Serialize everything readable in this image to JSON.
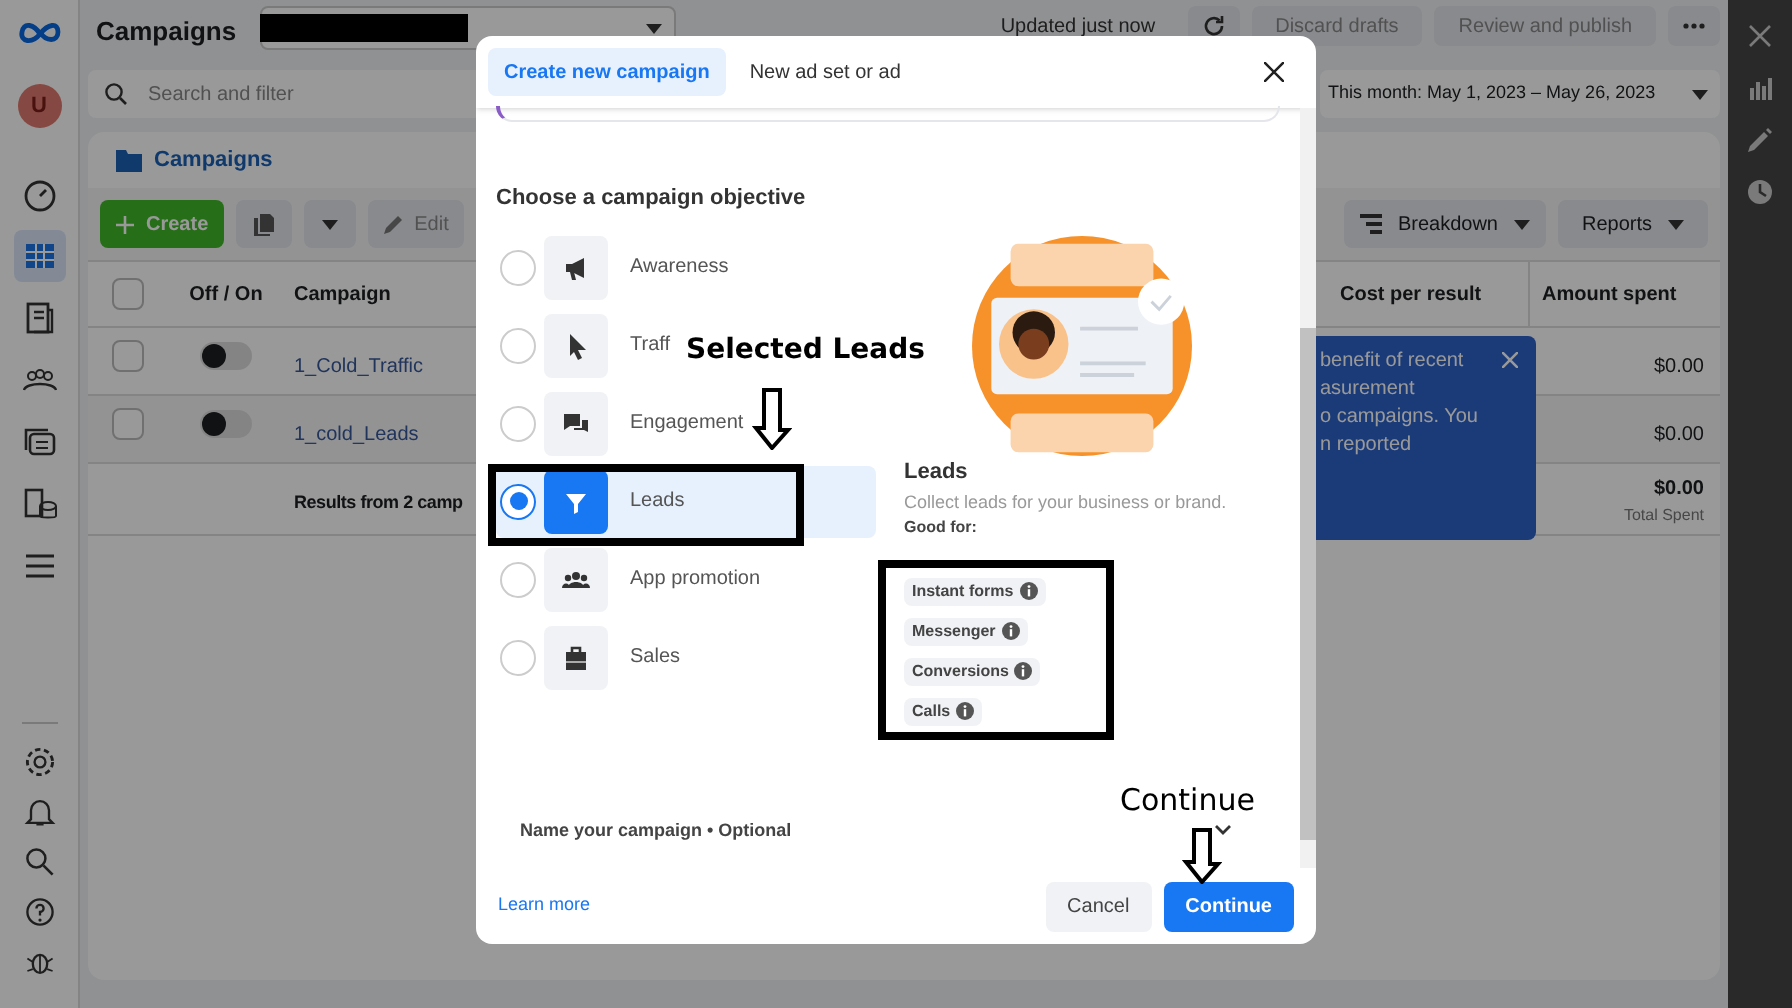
{
  "app": {
    "title": "Campaigns",
    "avatar": "U",
    "updated": "Updated just now",
    "actions": [
      "Discard drafts",
      "Review and publish"
    ],
    "search_placeholder": "Search and filter",
    "date_range": "This month: May 1, 2023 – May 26, 2023"
  },
  "nav_items": [
    {
      "selected": false
    },
    {
      "selected": true
    },
    {
      "selected": false
    },
    {
      "selected": false
    },
    {
      "selected": false
    },
    {
      "selected": false
    },
    {
      "selected": false
    }
  ],
  "panel": {
    "tab": "Campaigns",
    "create": "Create",
    "edit": "Edit",
    "breakdown": "Breakdown",
    "reports": "Reports",
    "columns": [
      "Off / On",
      "Campaign",
      "Cost per result",
      "Amount spent"
    ],
    "all_checked": false,
    "rows": [
      {
        "name": "1_Cold_Traffic",
        "checked": false,
        "on": false,
        "amount": "$0.00"
      },
      {
        "name": "1_cold_Leads",
        "checked": false,
        "on": false,
        "amount": "$0.00"
      }
    ],
    "footer": {
      "results": "Results from 2 camp",
      "amount": "$0.00",
      "note": "Total Spent"
    },
    "notice_lines": [
      "benefit of recent",
      "asurement",
      "o campaigns. You",
      "n reported"
    ]
  },
  "modal": {
    "tabs": [
      {
        "label": "Create new campaign",
        "selected": true
      },
      {
        "label": "New ad set or ad",
        "selected": false
      }
    ],
    "heading": "Choose a campaign objective",
    "objectives": [
      {
        "label": "Awareness",
        "selected": false
      },
      {
        "label": "Traff",
        "selected": false
      },
      {
        "label": "Engagement",
        "selected": false
      },
      {
        "label": "Leads",
        "selected": true
      },
      {
        "label": "App promotion",
        "selected": false
      },
      {
        "label": "Sales",
        "selected": false
      }
    ],
    "detail": {
      "title": "Leads",
      "description": "Collect leads for your business or brand.",
      "good_for": "Good for:",
      "chips": [
        "Instant forms",
        "Messenger",
        "Conversions",
        "Calls"
      ]
    },
    "name_label": "Name your campaign • Optional",
    "learn_more": "Learn more",
    "cancel": "Cancel",
    "continue": "Continue"
  },
  "annotations": [
    {
      "text": "Selected Leads"
    },
    {
      "text": "Continue"
    }
  ]
}
